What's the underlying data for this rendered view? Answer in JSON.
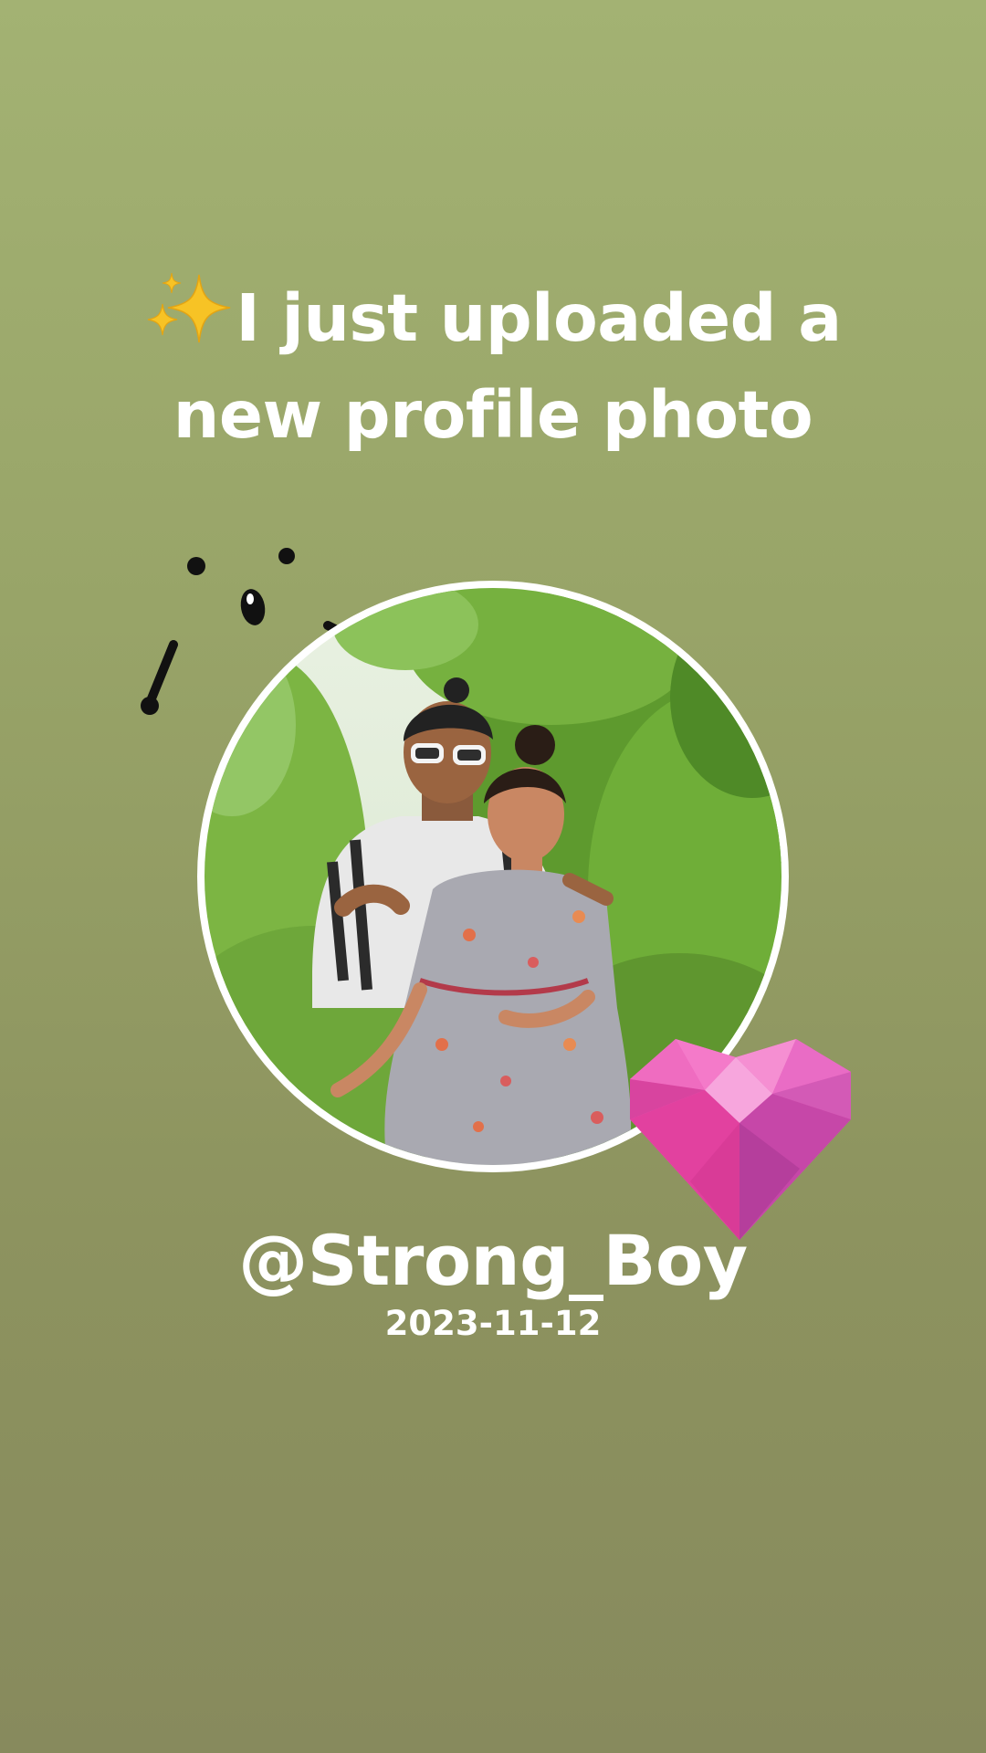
{
  "story": {
    "headline_emoji": "sparkles-icon",
    "headline_line1": "I just uploaded a",
    "headline_line2": "new profile photo",
    "username": "@Strong_Boy",
    "date": "2023-11-12",
    "photo_alt": "profile photo",
    "stickers": [
      "face-doodle-sticker",
      "pink-gem-heart-sticker"
    ]
  },
  "colors": {
    "background_top": "#a3b273",
    "background_bottom": "#878a5d",
    "text": "#ffffff",
    "frame": "#ffffff",
    "heart": "#e64fb0"
  }
}
